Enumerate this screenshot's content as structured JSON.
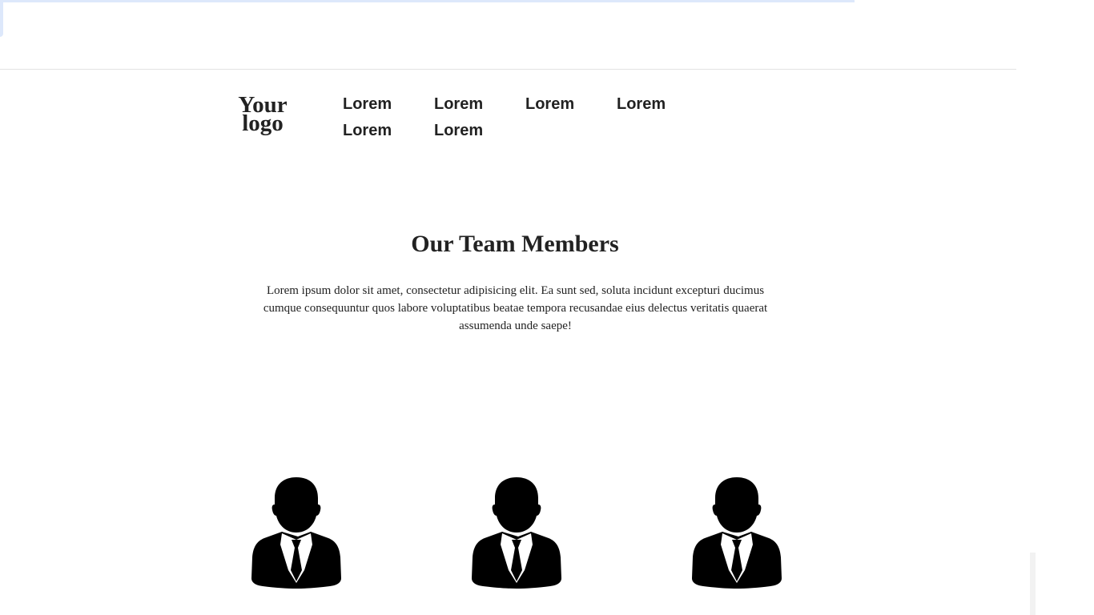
{
  "header": {
    "logo_text": "Your logo",
    "nav_items": [
      {
        "label": "Lorem"
      },
      {
        "label": "Lorem"
      },
      {
        "label": "Lorem"
      },
      {
        "label": "Lorem"
      },
      {
        "label": "Lorem"
      },
      {
        "label": "Lorem"
      }
    ]
  },
  "team_section": {
    "title": "Our Team Members",
    "description": "Lorem ipsum dolor sit amet, consectetur adipisicing elit. Ea sunt sed, soluta incidunt excepturi ducimus cumque consequuntur quos labore voluptatibus beatae tempora recusandae eius delectus veritatis quaerat assumenda unde saepe!",
    "members": [
      {
        "icon": "businessman-avatar-icon"
      },
      {
        "icon": "businessman-avatar-icon"
      },
      {
        "icon": "businessman-avatar-icon"
      }
    ]
  },
  "colors": {
    "text": "#222222",
    "avatar": "#000000",
    "top_strip": "#dde8fb",
    "divider": "#e3e3e3"
  }
}
